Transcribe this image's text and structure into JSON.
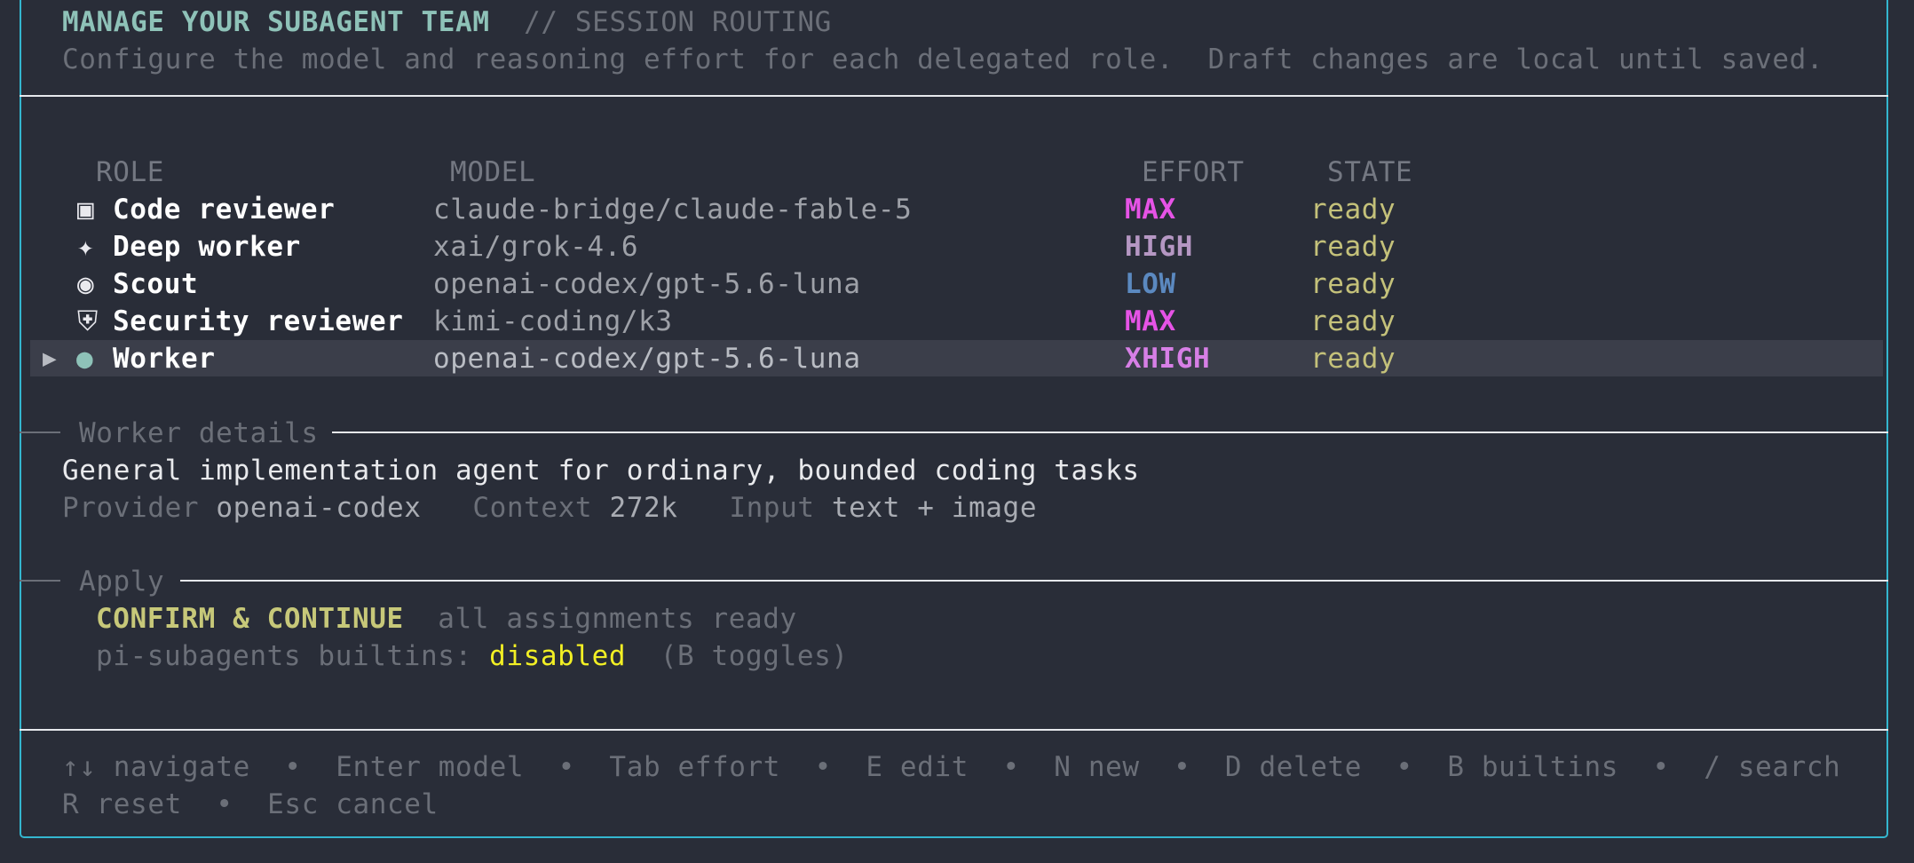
{
  "header": {
    "title": "MANAGE YOUR SUBAGENT TEAM",
    "subtitle": "// SESSION ROUTING",
    "description": "Configure the model and reasoning effort for each delegated role.",
    "note": "Draft changes are local until saved."
  },
  "table": {
    "columns": {
      "role": "ROLE",
      "model": "MODEL",
      "effort": "EFFORT",
      "state": "STATE"
    },
    "rows": [
      {
        "icon": "▣",
        "icon_name": "square-icon",
        "role": "Code reviewer",
        "model": "claude-bridge/claude-fable-5",
        "effort": "MAX",
        "effort_color": "#e653e6",
        "state": "ready"
      },
      {
        "icon": "✦",
        "icon_name": "sparkle-icon",
        "role": "Deep worker",
        "model": "xai/grok-4.6",
        "effort": "HIGH",
        "effort_color": "#b597c3",
        "state": "ready"
      },
      {
        "icon": "◉",
        "icon_name": "target-icon",
        "role": "Scout",
        "model": "openai-codex/gpt-5.6-luna",
        "effort": "LOW",
        "effort_color": "#5b89c0",
        "state": "ready"
      },
      {
        "icon": "⛨",
        "icon_name": "shield-icon",
        "role": "Security reviewer",
        "model": "kimi-coding/k3",
        "effort": "MAX",
        "effort_color": "#e653e6",
        "state": "ready"
      },
      {
        "icon": "●",
        "icon_name": "dot-icon",
        "role": "Worker",
        "model": "openai-codex/gpt-5.6-luna",
        "effort": "XHIGH",
        "effort_color": "#d77fe6",
        "state": "ready",
        "selected": true,
        "cursor": "▶"
      }
    ]
  },
  "details": {
    "title": "Worker details",
    "description": "General implementation agent for ordinary, bounded coding tasks",
    "provider_label": "Provider",
    "provider_value": "openai-codex",
    "context_label": "Context",
    "context_value": "272k",
    "input_label": "Input",
    "input_value": "text + image"
  },
  "apply": {
    "title": "Apply",
    "confirm_label": "CONFIRM & CONTINUE",
    "confirm_status": "all assignments ready",
    "builtins_label": "pi-subagents builtins:",
    "builtins_value": "disabled",
    "builtins_hint": "(B toggles)"
  },
  "footer": {
    "line1": "↑↓ navigate  •  Enter model  •  Tab effort  •  E edit  •  N new  •  D delete  •  B builtins  •  / search",
    "line2": "R reset  •  Esc cancel"
  },
  "colors": {
    "background": "#292d38",
    "frame_border": "#34b6cf",
    "accent_title": "#8ec2b8",
    "ready": "#c4c17a",
    "disabled": "#f2ef24"
  }
}
